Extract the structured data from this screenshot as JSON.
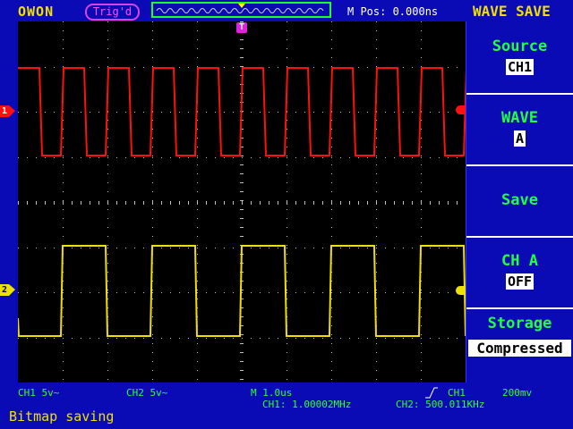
{
  "header": {
    "brand": "OWON",
    "trigger_status": "Trig'd",
    "m_pos": "M Pos: 0.000ns",
    "screen_title": "WAVE SAVE"
  },
  "menu": {
    "source_label": "Source",
    "source_value": "CH1",
    "wave_label": "WAVE",
    "wave_value": "A",
    "save_label": "Save",
    "cha_label": "CH A",
    "cha_value": "OFF",
    "storage_label": "Storage",
    "storage_value": "Compressed"
  },
  "status": {
    "ch1_scale": "CH1  5v~",
    "ch2_scale": "CH2  5v~",
    "timebase": "M  1.0us",
    "trigger_source": "CH1",
    "trigger_level": "200mv",
    "ch1_freq": "CH1: 1.00002MHz",
    "ch2_freq": "CH2: 500.011KHz",
    "message": "Bitmap saving"
  },
  "markers": {
    "ch1": "1",
    "ch2": "2",
    "trigger": "T"
  },
  "colors": {
    "ch1": "#ff1010",
    "ch2": "#f0e000",
    "grid": "#c0c0c0",
    "menu_label": "#20ff40"
  }
}
